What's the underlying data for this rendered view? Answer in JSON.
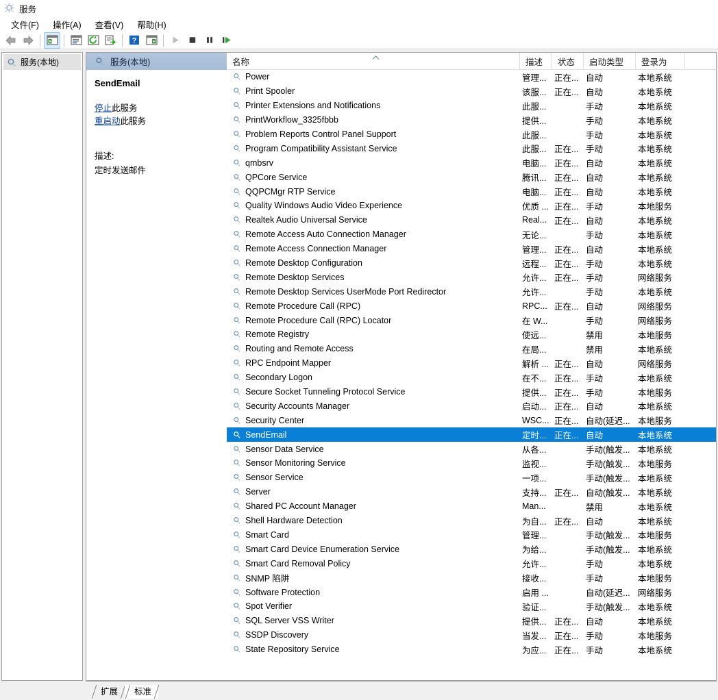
{
  "window": {
    "title": "服务",
    "icon": "services-gear-icon"
  },
  "menu": {
    "items": [
      {
        "label": "文件(F)",
        "name": "menu-file"
      },
      {
        "label": "操作(A)",
        "name": "menu-action"
      },
      {
        "label": "查看(V)",
        "name": "menu-view"
      },
      {
        "label": "帮助(H)",
        "name": "menu-help"
      }
    ]
  },
  "toolbar": {
    "buttons": [
      {
        "icon": "back-arrow-icon",
        "name": "toolbar-back"
      },
      {
        "icon": "forward-arrow-icon",
        "name": "toolbar-forward"
      },
      {
        "icon": "show-hide-tree-icon",
        "name": "toolbar-show-hide-console-tree"
      },
      {
        "icon": "properties-icon",
        "name": "toolbar-properties"
      },
      {
        "icon": "refresh-icon",
        "name": "toolbar-refresh"
      },
      {
        "icon": "export-list-icon",
        "name": "toolbar-export-list"
      },
      {
        "icon": "help-icon",
        "name": "toolbar-help"
      },
      {
        "icon": "show-action-pane-icon",
        "name": "toolbar-show-action-pane"
      },
      {
        "icon": "play-icon",
        "name": "toolbar-start-service"
      },
      {
        "icon": "stop-icon",
        "name": "toolbar-stop-service"
      },
      {
        "icon": "pause-icon",
        "name": "toolbar-pause-service"
      },
      {
        "icon": "restart-icon",
        "name": "toolbar-restart-service"
      }
    ]
  },
  "tree": {
    "root_label": "服务(本地)",
    "root_icon": "services-node-icon"
  },
  "pane": {
    "header_label": "服务(本地)",
    "header_icon": "services-node-icon"
  },
  "details": {
    "service_name": "SendEmail",
    "stop_link": "停止",
    "stop_suffix": "此服务",
    "restart_link": "重启动",
    "restart_suffix": "此服务",
    "description_label": "描述:",
    "description_text": "定时发送邮件"
  },
  "list": {
    "columns": [
      {
        "key": "name",
        "label": "名称",
        "sorted": "asc"
      },
      {
        "key": "desc",
        "label": "描述"
      },
      {
        "key": "state",
        "label": "状态"
      },
      {
        "key": "start",
        "label": "启动类型"
      },
      {
        "key": "logon",
        "label": "登录为"
      }
    ],
    "sort_caret": "︿",
    "rows": [
      {
        "name": "Power",
        "desc": "管理...",
        "state": "正在...",
        "start": "自动",
        "logon": "本地系统",
        "selected": false
      },
      {
        "name": "Print Spooler",
        "desc": "该服...",
        "state": "正在...",
        "start": "自动",
        "logon": "本地系统",
        "selected": false
      },
      {
        "name": "Printer Extensions and Notifications",
        "desc": "此服...",
        "state": "",
        "start": "手动",
        "logon": "本地系统",
        "selected": false
      },
      {
        "name": "PrintWorkflow_3325fbbb",
        "desc": "提供...",
        "state": "",
        "start": "手动",
        "logon": "本地系统",
        "selected": false
      },
      {
        "name": "Problem Reports Control Panel Support",
        "desc": "此服...",
        "state": "",
        "start": "手动",
        "logon": "本地系统",
        "selected": false
      },
      {
        "name": "Program Compatibility Assistant Service",
        "desc": "此服...",
        "state": "正在...",
        "start": "手动",
        "logon": "本地系统",
        "selected": false
      },
      {
        "name": "qmbsrv",
        "desc": "电脑...",
        "state": "正在...",
        "start": "自动",
        "logon": "本地系统",
        "selected": false
      },
      {
        "name": "QPCore Service",
        "desc": "腾讯...",
        "state": "正在...",
        "start": "自动",
        "logon": "本地系统",
        "selected": false
      },
      {
        "name": "QQPCMgr RTP Service",
        "desc": "电脑...",
        "state": "正在...",
        "start": "自动",
        "logon": "本地系统",
        "selected": false
      },
      {
        "name": "Quality Windows Audio Video Experience",
        "desc": "优质 ...",
        "state": "正在...",
        "start": "手动",
        "logon": "本地服务",
        "selected": false
      },
      {
        "name": "Realtek Audio Universal Service",
        "desc": "Real...",
        "state": "正在...",
        "start": "自动",
        "logon": "本地系统",
        "selected": false
      },
      {
        "name": "Remote Access Auto Connection Manager",
        "desc": "无论...",
        "state": "",
        "start": "手动",
        "logon": "本地系统",
        "selected": false
      },
      {
        "name": "Remote Access Connection Manager",
        "desc": "管理...",
        "state": "正在...",
        "start": "自动",
        "logon": "本地系统",
        "selected": false
      },
      {
        "name": "Remote Desktop Configuration",
        "desc": "远程...",
        "state": "正在...",
        "start": "手动",
        "logon": "本地系统",
        "selected": false
      },
      {
        "name": "Remote Desktop Services",
        "desc": "允许...",
        "state": "正在...",
        "start": "手动",
        "logon": "网络服务",
        "selected": false
      },
      {
        "name": "Remote Desktop Services UserMode Port Redirector",
        "desc": "允许...",
        "state": "",
        "start": "手动",
        "logon": "本地系统",
        "selected": false
      },
      {
        "name": "Remote Procedure Call (RPC)",
        "desc": "RPC...",
        "state": "正在...",
        "start": "自动",
        "logon": "网络服务",
        "selected": false
      },
      {
        "name": "Remote Procedure Call (RPC) Locator",
        "desc": "在 W...",
        "state": "",
        "start": "手动",
        "logon": "网络服务",
        "selected": false
      },
      {
        "name": "Remote Registry",
        "desc": "使远...",
        "state": "",
        "start": "禁用",
        "logon": "本地服务",
        "selected": false
      },
      {
        "name": "Routing and Remote Access",
        "desc": "在局...",
        "state": "",
        "start": "禁用",
        "logon": "本地系统",
        "selected": false
      },
      {
        "name": "RPC Endpoint Mapper",
        "desc": "解析 ...",
        "state": "正在...",
        "start": "自动",
        "logon": "网络服务",
        "selected": false
      },
      {
        "name": "Secondary Logon",
        "desc": "在不...",
        "state": "正在...",
        "start": "手动",
        "logon": "本地系统",
        "selected": false
      },
      {
        "name": "Secure Socket Tunneling Protocol Service",
        "desc": "提供...",
        "state": "正在...",
        "start": "手动",
        "logon": "本地服务",
        "selected": false
      },
      {
        "name": "Security Accounts Manager",
        "desc": "启动...",
        "state": "正在...",
        "start": "自动",
        "logon": "本地系统",
        "selected": false
      },
      {
        "name": "Security Center",
        "desc": "WSC...",
        "state": "正在...",
        "start": "自动(延迟...",
        "logon": "本地服务",
        "selected": false
      },
      {
        "name": "SendEmail",
        "desc": "定时...",
        "state": "正在...",
        "start": "自动",
        "logon": "本地系统",
        "selected": true
      },
      {
        "name": "Sensor Data Service",
        "desc": "从各...",
        "state": "",
        "start": "手动(触发...",
        "logon": "本地系统",
        "selected": false
      },
      {
        "name": "Sensor Monitoring Service",
        "desc": "监视...",
        "state": "",
        "start": "手动(触发...",
        "logon": "本地服务",
        "selected": false
      },
      {
        "name": "Sensor Service",
        "desc": "一项...",
        "state": "",
        "start": "手动(触发...",
        "logon": "本地系统",
        "selected": false
      },
      {
        "name": "Server",
        "desc": "支持...",
        "state": "正在...",
        "start": "自动(触发...",
        "logon": "本地系统",
        "selected": false
      },
      {
        "name": "Shared PC Account Manager",
        "desc": "Man...",
        "state": "",
        "start": "禁用",
        "logon": "本地系统",
        "selected": false
      },
      {
        "name": "Shell Hardware Detection",
        "desc": "为自...",
        "state": "正在...",
        "start": "自动",
        "logon": "本地系统",
        "selected": false
      },
      {
        "name": "Smart Card",
        "desc": "管理...",
        "state": "",
        "start": "手动(触发...",
        "logon": "本地服务",
        "selected": false
      },
      {
        "name": "Smart Card Device Enumeration Service",
        "desc": "为给...",
        "state": "",
        "start": "手动(触发...",
        "logon": "本地系统",
        "selected": false
      },
      {
        "name": "Smart Card Removal Policy",
        "desc": "允许...",
        "state": "",
        "start": "手动",
        "logon": "本地系统",
        "selected": false
      },
      {
        "name": "SNMP 陷阱",
        "desc": "接收...",
        "state": "",
        "start": "手动",
        "logon": "本地服务",
        "selected": false
      },
      {
        "name": "Software Protection",
        "desc": "启用 ...",
        "state": "",
        "start": "自动(延迟...",
        "logon": "网络服务",
        "selected": false
      },
      {
        "name": "Spot Verifier",
        "desc": "验证...",
        "state": "",
        "start": "手动(触发...",
        "logon": "本地系统",
        "selected": false
      },
      {
        "name": "SQL Server VSS Writer",
        "desc": "提供...",
        "state": "正在...",
        "start": "自动",
        "logon": "本地系统",
        "selected": false
      },
      {
        "name": "SSDP Discovery",
        "desc": "当发...",
        "state": "正在...",
        "start": "手动",
        "logon": "本地服务",
        "selected": false
      },
      {
        "name": "State Repository Service",
        "desc": "为应...",
        "state": "正在...",
        "start": "手动",
        "logon": "本地系统",
        "selected": false
      }
    ]
  },
  "tabs": {
    "items": [
      {
        "label": "扩展",
        "active": false
      },
      {
        "label": "标准",
        "active": true
      }
    ]
  },
  "colors": {
    "selection": "#0a7fd6",
    "pane_header": "#a7bdd7",
    "link": "#0b3f9e"
  }
}
